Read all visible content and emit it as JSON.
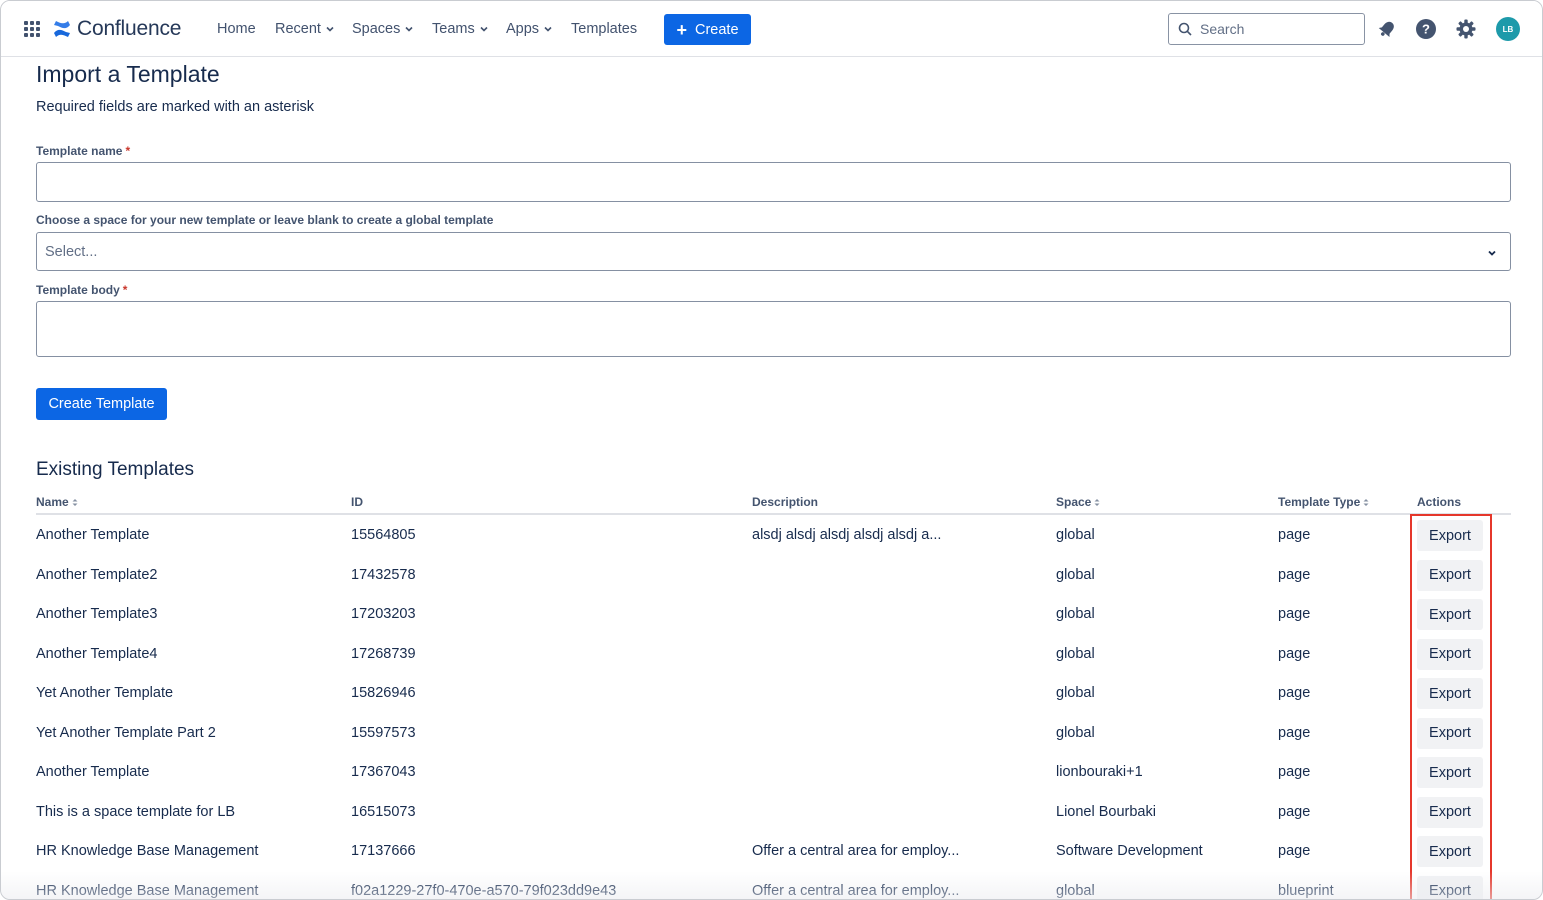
{
  "nav": {
    "brand": "Confluence",
    "items": [
      {
        "label": "Home",
        "dropdown": false
      },
      {
        "label": "Recent",
        "dropdown": true
      },
      {
        "label": "Spaces",
        "dropdown": true
      },
      {
        "label": "Teams",
        "dropdown": true
      },
      {
        "label": "Apps",
        "dropdown": true
      },
      {
        "label": "Templates",
        "dropdown": false
      }
    ],
    "create_label": "Create",
    "search_placeholder": "Search",
    "avatar_initials": "LB",
    "icons": [
      "app-switcher-icon",
      "notifications-icon",
      "help-icon",
      "settings-icon"
    ],
    "accent": "#0c66e4"
  },
  "form": {
    "title": "Import a Template",
    "required_note": "Required fields are marked with an asterisk",
    "name_label": "Template name",
    "space_label": "Choose a space for your new template or leave blank to create a global template",
    "space_placeholder": "Select...",
    "body_label": "Template body",
    "asterisk": "*",
    "submit_label": "Create Template"
  },
  "templates": {
    "heading": "Existing Templates",
    "columns": {
      "name": "Name",
      "id": "ID",
      "description": "Description",
      "space": "Space",
      "type": "Template Type",
      "actions": "Actions"
    },
    "export_label": "Export",
    "rows": [
      {
        "name": "Another Template",
        "id": "15564805",
        "description": "alsdj alsdj alsdj alsdj alsdj a...",
        "space": "global",
        "type": "page"
      },
      {
        "name": "Another Template2",
        "id": "17432578",
        "description": "",
        "space": "global",
        "type": "page"
      },
      {
        "name": "Another Template3",
        "id": "17203203",
        "description": "",
        "space": "global",
        "type": "page"
      },
      {
        "name": "Another Template4",
        "id": "17268739",
        "description": "",
        "space": "global",
        "type": "page"
      },
      {
        "name": "Yet Another Template",
        "id": "15826946",
        "description": "",
        "space": "global",
        "type": "page"
      },
      {
        "name": "Yet Another Template Part 2",
        "id": "15597573",
        "description": "",
        "space": "global",
        "type": "page"
      },
      {
        "name": "Another Template",
        "id": "17367043",
        "description": "",
        "space": "lionbouraki+1",
        "type": "page"
      },
      {
        "name": "This is a space template for LB",
        "id": "16515073",
        "description": "",
        "space": "Lionel Bourbaki",
        "type": "page"
      },
      {
        "name": "HR Knowledge Base Management",
        "id": "17137666",
        "description": "Offer a central area for employ...",
        "space": "Software Development",
        "type": "page"
      },
      {
        "name": "HR Knowledge Base Management",
        "id": "f02a1229-27f0-470e-a570-79f023dd9e43",
        "description": "Offer a central area for employ...",
        "space": "global",
        "type": "blueprint"
      }
    ]
  }
}
